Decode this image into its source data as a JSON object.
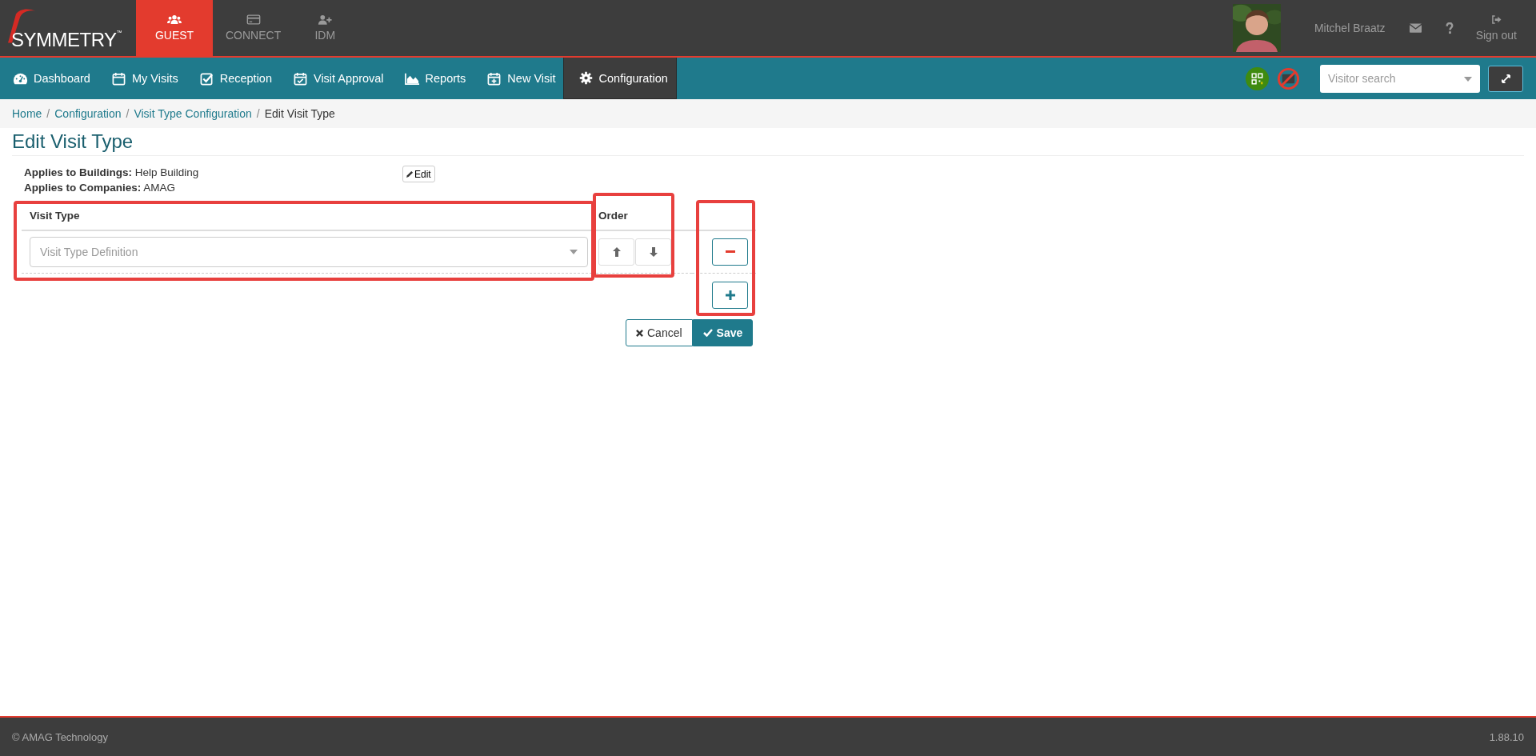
{
  "header": {
    "logo": "SYMMETRY",
    "logo_mark": "™",
    "apps": [
      {
        "label": "GUEST",
        "selected": true
      },
      {
        "label": "CONNECT",
        "selected": false
      },
      {
        "label": "IDM",
        "selected": false
      }
    ],
    "user_name": "Mitchel Braatz",
    "sign_out": "Sign out"
  },
  "nav": {
    "items": [
      {
        "label": "Dashboard",
        "selected": false
      },
      {
        "label": "My Visits",
        "selected": false
      },
      {
        "label": "Reception",
        "selected": false
      },
      {
        "label": "Visit Approval",
        "selected": false
      },
      {
        "label": "Reports",
        "selected": false
      },
      {
        "label": "New Visit",
        "selected": false
      },
      {
        "label": "Configuration",
        "selected": true
      }
    ],
    "search": {
      "placeholder": "Visitor search"
    }
  },
  "breadcrumb": [
    {
      "label": "Home",
      "link": true
    },
    {
      "separator": "/",
      "label": "Configuration",
      "link": true
    },
    {
      "separator": "/",
      "label": "Visit Type Configuration",
      "link": true
    },
    {
      "separator": "/",
      "label": "Edit Visit Type",
      "link": false
    }
  ],
  "title": "Edit Visit Type",
  "applies": [
    {
      "label": "Applies to Buildings:",
      "value": "Help Building"
    },
    {
      "label": "Applies to Companies:",
      "value": "AMAG"
    }
  ],
  "edit_button": "Edit",
  "table": {
    "columns": [
      "Visit Type",
      "Order"
    ],
    "rows": [
      {
        "placeholder": "Visit Type Definition"
      }
    ]
  },
  "actions": [
    {
      "label": "Cancel",
      "kind": "cancel"
    },
    {
      "label": "Save",
      "kind": "save"
    }
  ],
  "footer": {
    "copyright": "© AMAG Technology",
    "version": "1.88.10"
  }
}
